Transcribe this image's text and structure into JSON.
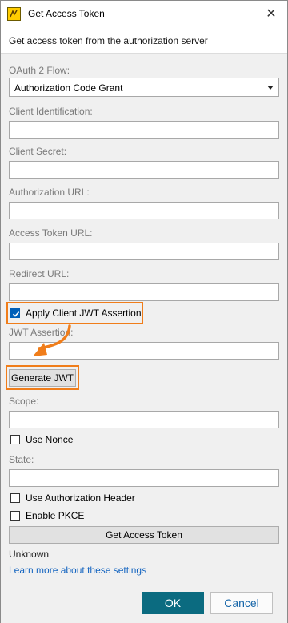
{
  "window": {
    "title": "Get Access Token",
    "close_glyph": "✕"
  },
  "header": {
    "subtitle": "Get access token from the authorization server"
  },
  "form": {
    "flow_label": "OAuth 2 Flow:",
    "flow_value": "Authorization Code Grant",
    "client_id_label": "Client Identification:",
    "client_secret_label": "Client Secret:",
    "auth_url_label": "Authorization URL:",
    "token_url_label": "Access Token URL:",
    "redirect_url_label": "Redirect URL:",
    "jwt_assertion_checkbox": "Apply Client JWT Assertion",
    "jwt_assertion_label": "JWT Assertion:",
    "generate_jwt": "Generate JWT",
    "scope_label": "Scope:",
    "use_nonce": "Use Nonce",
    "state_label": "State:",
    "use_auth_header": "Use Authorization Header",
    "enable_pkce": "Enable PKCE",
    "get_access_token": "Get Access Token",
    "status": "Unknown",
    "learn_more": "Learn more about these settings"
  },
  "checkboxes": {
    "apply_jwt": true,
    "use_nonce": false,
    "use_auth_header": false,
    "enable_pkce": false
  },
  "footer": {
    "ok": "OK",
    "cancel": "Cancel"
  },
  "colors": {
    "highlight": "#f07d1a",
    "ok_bg": "#0b6b80",
    "link": "#1565c0",
    "check": "#005fb8"
  },
  "icons": [
    "app-icon",
    "close-icon",
    "checkmark-icon",
    "chevron-down-icon",
    "curved-arrow-icon"
  ]
}
